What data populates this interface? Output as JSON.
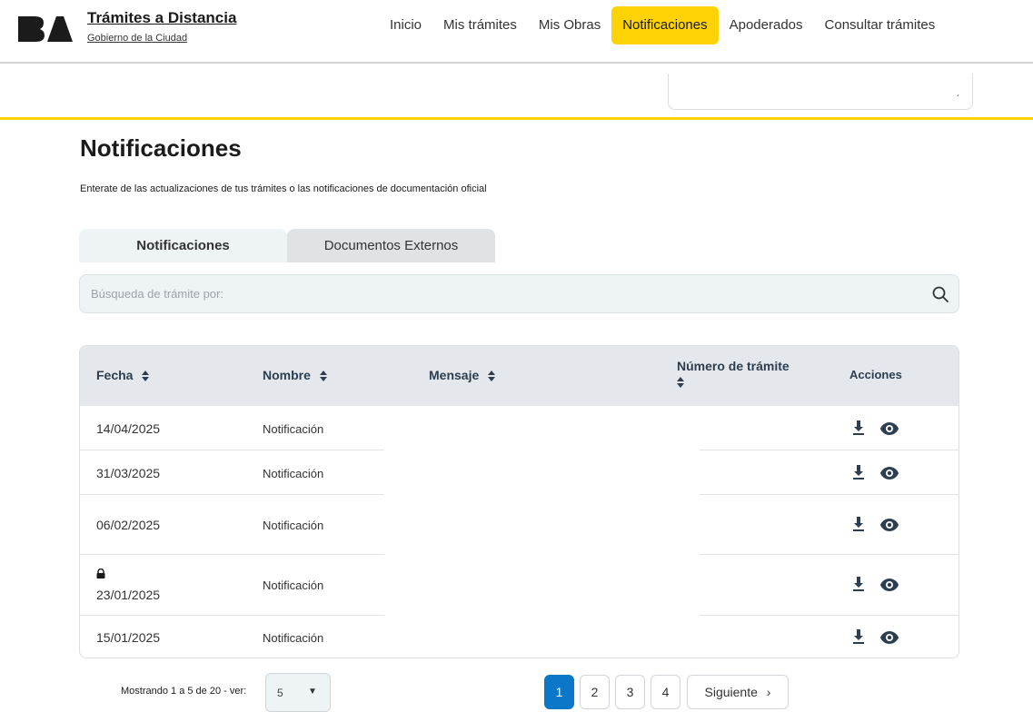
{
  "header": {
    "title": "Trámites a Distancia",
    "subtitle": "Gobierno de la Ciudad",
    "nav": [
      {
        "label": "Inicio",
        "active": false
      },
      {
        "label": "Mis trámites",
        "active": false
      },
      {
        "label": "Mis Obras",
        "active": false
      },
      {
        "label": "Notificaciones",
        "active": true
      },
      {
        "label": "Apoderados",
        "active": false
      },
      {
        "label": "Consultar trámites",
        "active": false
      }
    ]
  },
  "page": {
    "title": "Notificaciones",
    "description": "Enterate de las actualizaciones de tus trámites o las notificaciones de documentación oficial"
  },
  "tabs": [
    {
      "label": "Notificaciones",
      "active": true
    },
    {
      "label": "Documentos Externos",
      "active": false
    }
  ],
  "search": {
    "placeholder": "Búsqueda de trámite por:"
  },
  "table": {
    "columns": {
      "fecha": "Fecha",
      "nombre": "Nombre",
      "mensaje": "Mensaje",
      "numero": "Número de trámite",
      "acciones": "Acciones"
    },
    "rows": [
      {
        "date": "14/04/2025",
        "name": "Notificación",
        "locked": false
      },
      {
        "date": "31/03/2025",
        "name": "Notificación",
        "locked": false
      },
      {
        "date": "06/02/2025",
        "name": "Notificación",
        "locked": false
      },
      {
        "date": "23/01/2025",
        "name": "Notificación",
        "locked": true
      },
      {
        "date": "15/01/2025",
        "name": "Notificación",
        "locked": false
      }
    ]
  },
  "pagination": {
    "showing": "Mostrando 1 a 5 de 20 - ver:",
    "page_size": "5",
    "pages": [
      "1",
      "2",
      "3",
      "4"
    ],
    "current": "1",
    "next_label": "Siguiente"
  },
  "colors": {
    "accent_yellow": "#fdd306",
    "primary_blue": "#0b77c8",
    "header_gray": "#e4e8ec"
  }
}
